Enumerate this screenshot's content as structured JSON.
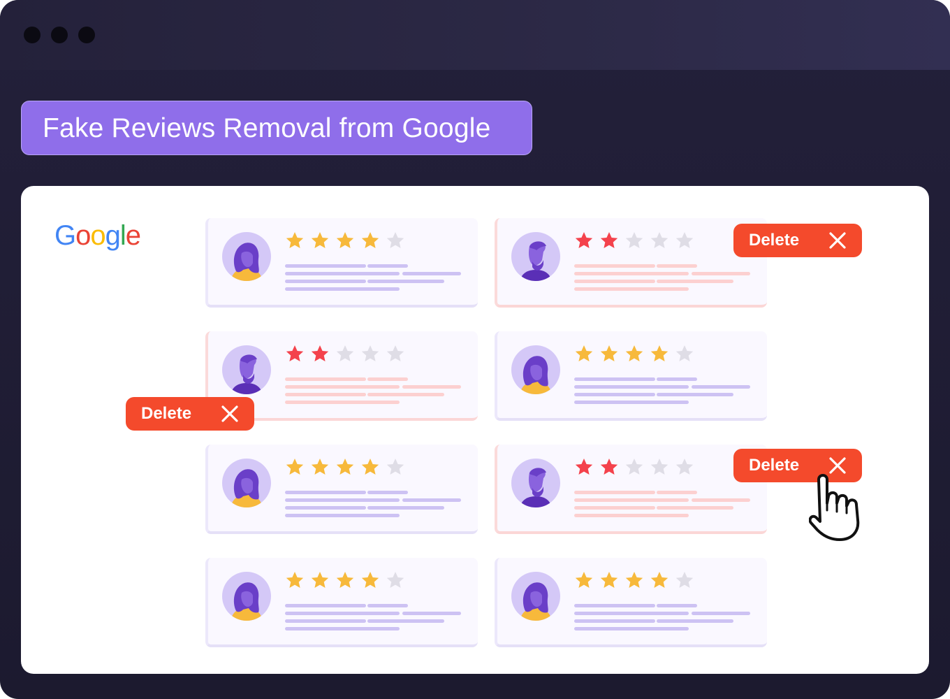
{
  "window": {
    "controls": [
      "window-dot",
      "window-dot",
      "window-dot"
    ]
  },
  "headline": {
    "text": "Fake Reviews Removal from Google"
  },
  "logo": {
    "letters": [
      "G",
      "o",
      "o",
      "g",
      "l",
      "e"
    ],
    "colors": [
      "#4285F4",
      "#EA4335",
      "#FBBC05",
      "#4285F4",
      "#34A853",
      "#EA4335"
    ]
  },
  "colors": {
    "star_good": "#f7b93b",
    "star_bad": "#f4424c",
    "star_empty": "#dfdde6",
    "text_line_good": "#cdc2f3",
    "text_line_bad": "#fcd0d0",
    "delete_button": "#f44a2c",
    "avatar_bg": "#d4c8f7",
    "avatar_figure": "#6a3fc8"
  },
  "reviews": [
    {
      "rating": 4,
      "avatar": "female",
      "flagged": false
    },
    {
      "rating": 2,
      "avatar": "male",
      "flagged": true
    },
    {
      "rating": 2,
      "avatar": "male",
      "flagged": true
    },
    {
      "rating": 4,
      "avatar": "female",
      "flagged": false
    },
    {
      "rating": 4,
      "avatar": "female",
      "flagged": false
    },
    {
      "rating": 2,
      "avatar": "male",
      "flagged": true
    },
    {
      "rating": 4,
      "avatar": "female",
      "flagged": false
    },
    {
      "rating": 4,
      "avatar": "female",
      "flagged": false
    }
  ],
  "delete_buttons": [
    {
      "label": "Delete",
      "icon": "close-icon"
    },
    {
      "label": "Delete",
      "icon": "close-icon"
    },
    {
      "label": "Delete",
      "icon": "close-icon"
    }
  ],
  "cursor": {
    "icon": "hand-pointer-icon"
  }
}
